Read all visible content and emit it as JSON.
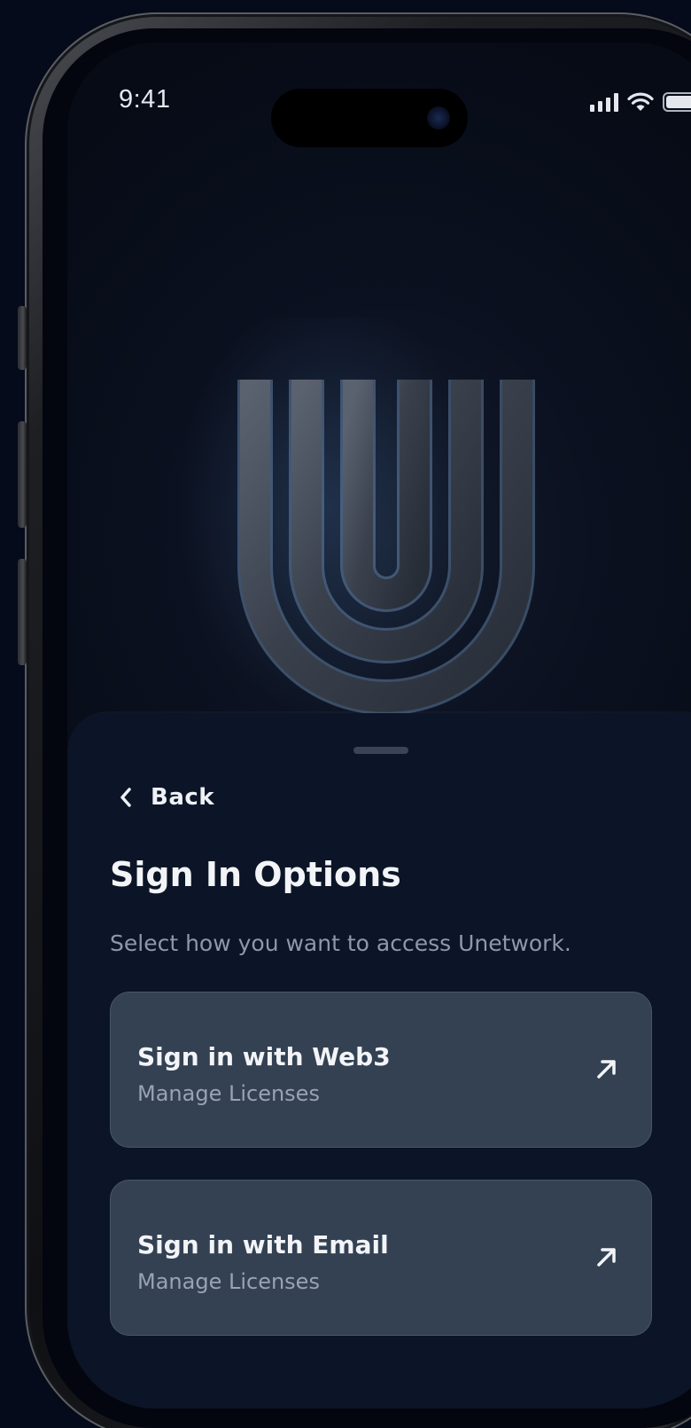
{
  "status_bar": {
    "time": "9:41"
  },
  "brand": {
    "logo_icon": "unetwork-u-logo-icon",
    "accent_color": "#5a8fd0"
  },
  "sheet": {
    "back_label": "Back",
    "title": "Sign In Options",
    "subtitle": "Select how you want to access Unetwork.",
    "options": [
      {
        "title": "Sign in with Web3",
        "subtitle": "Manage Licenses",
        "icon": "arrow-up-right-icon"
      },
      {
        "title": "Sign in with Email",
        "subtitle": "Manage Licenses",
        "icon": "arrow-up-right-icon"
      }
    ]
  },
  "colors": {
    "background": "#050b1a",
    "sheet": "#0c1527",
    "card": "#334152",
    "text": "#f2f4f8",
    "muted": "#8e98aa"
  }
}
